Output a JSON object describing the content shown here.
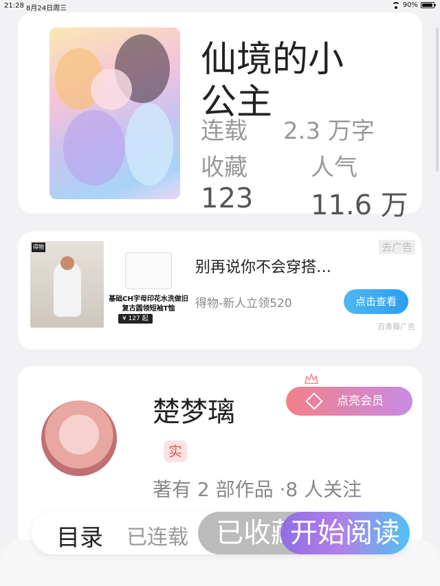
{
  "status_bar": {
    "time": "21:28",
    "date": "8月24日周三",
    "battery": "90%"
  },
  "book": {
    "title": "仙境的小公主",
    "status_label": "连载",
    "word_count": "2.3 万字",
    "fav_label": "收藏",
    "pop_label": "人气",
    "fav_count": "123",
    "pop_count": "11.6 万"
  },
  "ad": {
    "corner_label": "去广告",
    "title": "别再说你不会穿搭…",
    "subtitle": "得物-新人立领520",
    "button": "点击查看",
    "source": "百青藤广告",
    "thumb_tag": "得物",
    "shirt_text": "基础CH字母印花水洗做旧复古圆领短袖T恤",
    "price": "¥ 127 起"
  },
  "author": {
    "name": "楚梦璃",
    "real_badge": "实",
    "member_button": "点亮会员",
    "meta": "著有 2 部作品 ·8 人关注"
  },
  "bottom_bar": {
    "tab_catalog": "目录",
    "tab_status": "已连载",
    "fav_button": "已收藏",
    "read_button": "开始阅读"
  }
}
